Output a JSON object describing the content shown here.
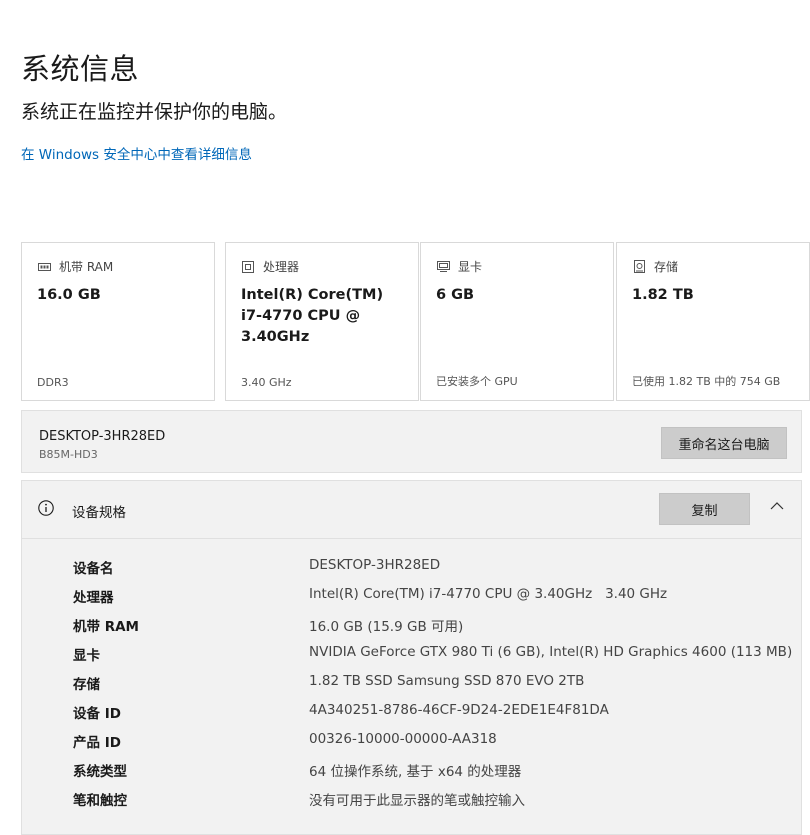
{
  "header": {
    "title": "系统信息",
    "subtitle": "系统正在监控并保护你的电脑。",
    "link": "在 Windows 安全中心中查看详细信息"
  },
  "cards": [
    {
      "icon": "memory-icon",
      "label": "机带 RAM",
      "value": "16.0 GB",
      "foot": "DDR3"
    },
    {
      "icon": "processor-icon",
      "label": "处理器",
      "value": "Intel(R) Core(TM) i7-4770 CPU @ 3.40GHz",
      "foot": "3.40 GHz"
    },
    {
      "icon": "graphics-card-icon",
      "label": "显卡",
      "value": "6 GB",
      "foot": "已安装多个 GPU"
    },
    {
      "icon": "storage-icon",
      "label": "存储",
      "value": "1.82 TB",
      "foot": "已使用 1.82 TB 中的 754 GB"
    }
  ],
  "device": {
    "name": "DESKTOP-3HR28ED",
    "model": "B85M-HD3",
    "rename_label": "重命名这台电脑"
  },
  "specs": {
    "title": "设备规格",
    "copy_label": "复制",
    "rows": [
      {
        "label": "设备名",
        "value": "DESKTOP-3HR28ED"
      },
      {
        "label": "处理器",
        "value": "Intel(R) Core(TM) i7-4770 CPU @ 3.40GHz   3.40 GHz"
      },
      {
        "label": "机带 RAM",
        "value": "16.0 GB (15.9 GB 可用)"
      },
      {
        "label": "显卡",
        "value": "NVIDIA GeForce GTX 980 Ti (6 GB), Intel(R) HD Graphics 4600 (113 MB)"
      },
      {
        "label": "存储",
        "value": "1.82 TB SSD Samsung SSD 870 EVO 2TB"
      },
      {
        "label": "设备 ID",
        "value": "4A340251-8786-46CF-9D24-2EDE1E4F81DA"
      },
      {
        "label": "产品 ID",
        "value": "00326-10000-00000-AA318"
      },
      {
        "label": "系统类型",
        "value": "64 位操作系统, 基于 x64 的处理器"
      },
      {
        "label": "笔和触控",
        "value": "没有可用于此显示器的笔或触控输入"
      }
    ]
  },
  "colors": {
    "link": "#0067b8",
    "button": "#cccccc",
    "panel": "#f2f2f2"
  }
}
